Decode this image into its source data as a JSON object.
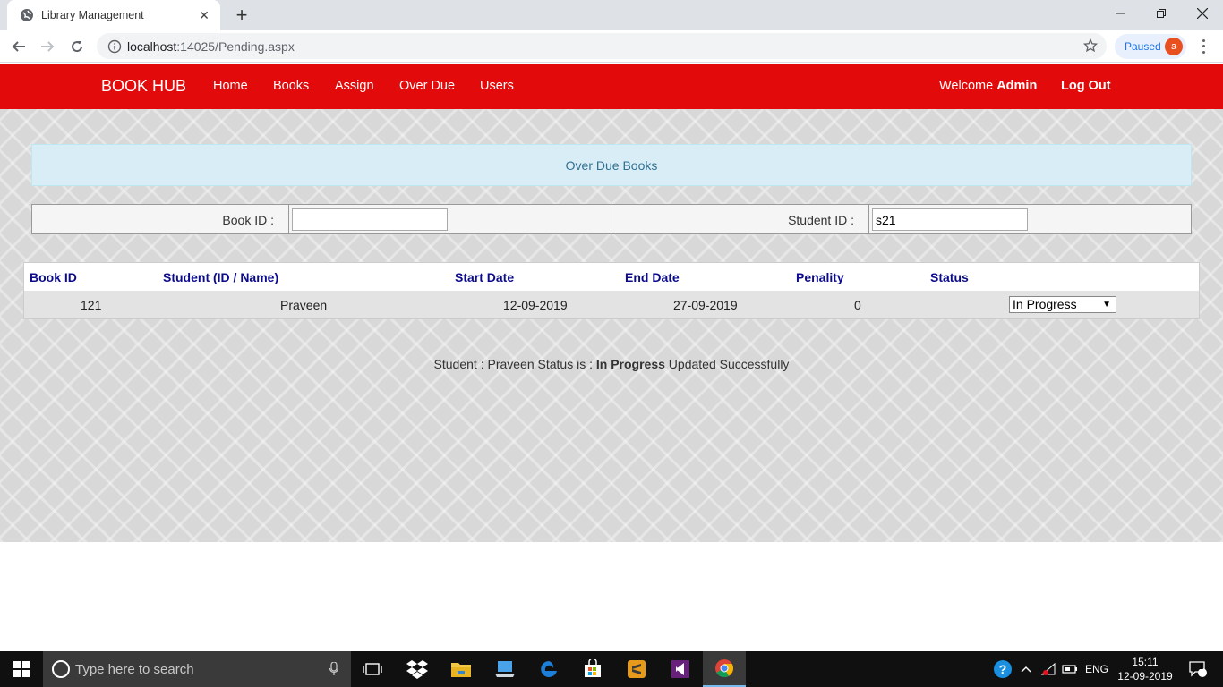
{
  "browser": {
    "tab_title": "Library Management",
    "url_host": "localhost",
    "url_path": ":14025/Pending.aspx",
    "profile_label": "Paused",
    "profile_initial": "a"
  },
  "navbar": {
    "brand": "BOOK HUB",
    "items": [
      "Home",
      "Books",
      "Assign",
      "Over Due",
      "Users"
    ],
    "welcome_prefix": "Welcome",
    "welcome_user": "Admin",
    "logout": "Log Out"
  },
  "banner": {
    "title": "Over Due Books"
  },
  "filter": {
    "book_id_label": "Book ID :",
    "book_id_value": "",
    "student_id_label": "Student ID :",
    "student_id_value": "s21"
  },
  "table": {
    "headers": [
      "Book ID",
      "Student (ID / Name)",
      "Start Date",
      "End Date",
      "Penality",
      "Status"
    ],
    "rows": [
      {
        "book_id": "121",
        "student": "Praveen",
        "start_date": "12-09-2019",
        "end_date": "27-09-2019",
        "penality": "0",
        "status": "In Progress"
      }
    ]
  },
  "message": {
    "prefix": "Student : Praveen Status is :",
    "status": "In Progress",
    "suffix": "Updated Successfully"
  },
  "taskbar": {
    "search_placeholder": "Type here to search",
    "lang": "ENG",
    "time": "15:11",
    "date": "12-09-2019",
    "notification_count": "1"
  },
  "colors": {
    "navbar": "#e20a0a",
    "banner_bg": "#d9edf7",
    "banner_text": "#31708f",
    "header_text": "#0b0b8c"
  }
}
